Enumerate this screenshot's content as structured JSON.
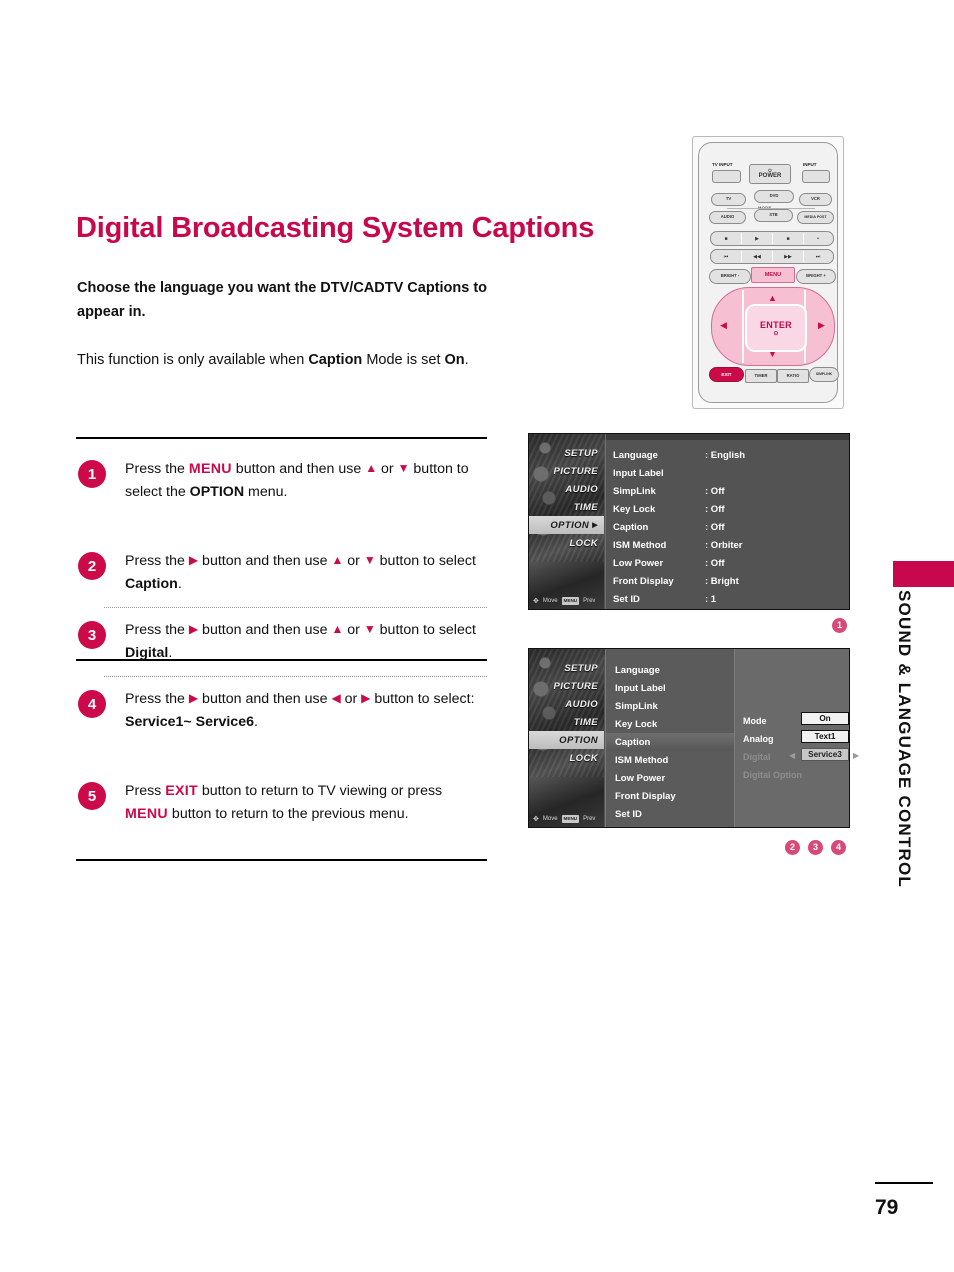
{
  "title": "Digital Broadcasting System Captions",
  "intro": {
    "line1": "Choose the language you want the DTV/CADTV Captions to appear in.",
    "line2_a": "This function is only available when ",
    "line2_b": "Caption",
    "line2_c": " Mode is set ",
    "line2_d": "On",
    "line2_e": "."
  },
  "steps": [
    {
      "num": "1",
      "a": "Press the ",
      "kw1": "MENU",
      "b": " button and then use ",
      "up": "▲",
      "c": " or ",
      "down": "▼",
      "d": " button to select the ",
      "kw2": "OPTION",
      "e": " menu."
    },
    {
      "num": "2",
      "a": "Press the ",
      "right": "▶",
      "b": " button and then use ",
      "up": "▲",
      "c": " or ",
      "down": "▼",
      "d": " button to select ",
      "kw2": "Caption",
      "e": "."
    },
    {
      "num": "3",
      "a": "Press the ",
      "right": "▶",
      "b": " button and then use ",
      "up": "▲",
      "c": " or ",
      "down": "▼",
      "d": " button to select ",
      "kw2": "Digital",
      "e": "."
    },
    {
      "num": "4",
      "a": "Press the ",
      "right": "▶",
      "b": " button and then use ",
      "left": "◀",
      "c": " or ",
      "right2": "▶",
      "d": " button to select: ",
      "kw2": "Service1~ Service6",
      "e": "."
    },
    {
      "num": "5",
      "a": "Press ",
      "kw1": "EXIT",
      "b": " button to return to TV viewing or press ",
      "kw2": "MENU",
      "c": " button to return to the previous menu."
    }
  ],
  "remote": {
    "tv_input": "TV INPUT",
    "power": "POWER",
    "power_glyph": "⏻",
    "input": "INPUT",
    "tv": "TV",
    "dvd": "DVD",
    "vcr": "VCR",
    "mode": "MODE",
    "audio": "AUDIO",
    "stb": "STB",
    "media_post": "MEDIA POST",
    "media_row1": [
      "■",
      "▶",
      "■",
      "•"
    ],
    "media_row2": [
      "⏮",
      "◀◀",
      "▶▶",
      "⏭"
    ],
    "bright_minus": "BRIGHT -",
    "menu": "MENU",
    "bright_plus": "BRIGHT +",
    "enter": "ENTER",
    "enter_glyph": "⊙",
    "arrow_up": "▲",
    "arrow_down": "▼",
    "arrow_left": "◀",
    "arrow_right": "▶",
    "exit": "EXIT",
    "timer": "TIMER",
    "ratio": "RATIO",
    "simplink": "SIMPLINK"
  },
  "osd_menu_tabs": [
    "SETUP",
    "PICTURE",
    "AUDIO",
    "TIME",
    "OPTION",
    "LOCK"
  ],
  "osd_footer": {
    "move": "Move",
    "move_icon": "✥",
    "menu_key": "MENU",
    "prev": "Prev"
  },
  "osd1": {
    "selected_tab": "OPTION",
    "rows": [
      {
        "label": "Language",
        "value": ": English"
      },
      {
        "label": "Input Label",
        "value": ""
      },
      {
        "label": "SimpLink",
        "value": ": Off"
      },
      {
        "label": "Key Lock",
        "value": ": Off"
      },
      {
        "label": "Caption",
        "value": ": Off"
      },
      {
        "label": "ISM Method",
        "value": ": Orbiter"
      },
      {
        "label": "Low Power",
        "value": ": Off"
      },
      {
        "label": "Front Display",
        "value": ": Bright"
      },
      {
        "label": "Set ID",
        "value": ": 1"
      }
    ]
  },
  "osd2": {
    "selected_tab": "OPTION",
    "selected_row": "Caption",
    "rows": [
      "Language",
      "Input Label",
      "SimpLink",
      "Key Lock",
      "Caption",
      "ISM Method",
      "Low Power",
      "Front Display",
      "Set ID"
    ],
    "detail": {
      "mode_label": "Mode",
      "mode_value": "On",
      "analog_label": "Analog",
      "analog_value": "Text1",
      "digital_label": "Digital",
      "digital_value": "Service3",
      "digital_option_label": "Digital Option",
      "arrow_left": "◀",
      "arrow_right": "▶"
    }
  },
  "markers": {
    "m1": "1",
    "m2": "2",
    "m3": "3",
    "m4": "4"
  },
  "side_label": "SOUND & LANGUAGE CONTROL",
  "page_number": "79",
  "colors": {
    "accent": "#c8084c",
    "marker": "#d74a78",
    "step_circle": "#cc0a4a"
  }
}
